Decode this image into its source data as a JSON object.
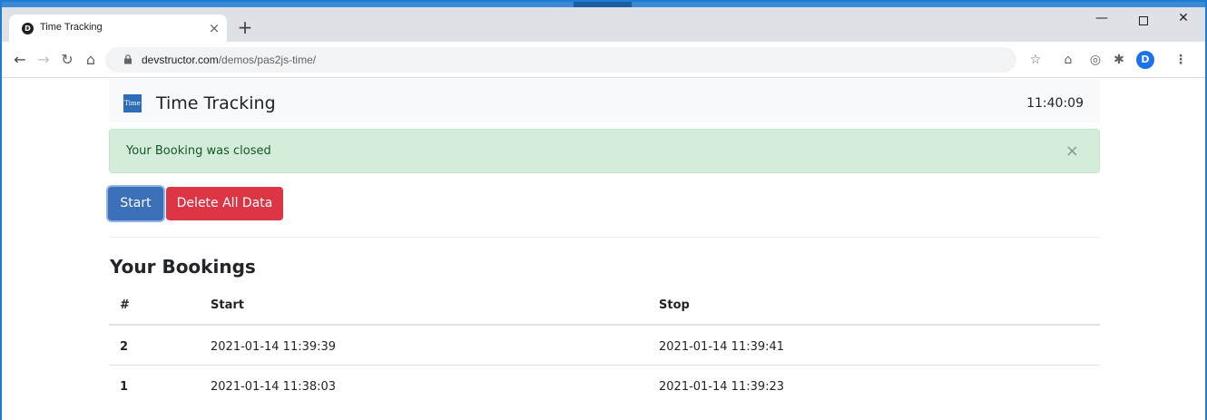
{
  "browser": {
    "tab_title": "Time Tracking",
    "tab_favicon": "D",
    "tab_close": "×",
    "new_tab": "+",
    "url_host": "devstructor.com",
    "url_path": "/demos/pas2js-time/",
    "profile_initial": "D",
    "icons": {
      "back": "arrow-left-icon",
      "forward": "arrow-right-icon",
      "reload": "reload-icon",
      "home": "home-icon",
      "lock": "lock-icon",
      "star": "star-icon",
      "menu": "kebab-menu-icon"
    }
  },
  "app": {
    "brand_logo_text": "Time",
    "brand_title": "Time Tracking",
    "clock": "11:40:09",
    "alert_message": "Your Booking was closed",
    "alert_close": "×",
    "start_label": "Start",
    "delete_label": "Delete All Data",
    "section_title": "Your Bookings",
    "colors": {
      "primary": "#3b6fb8",
      "danger": "#dc3545",
      "alert_bg": "#d4edda",
      "alert_text": "#155724"
    }
  },
  "table": {
    "headers": [
      "#",
      "Start",
      "Stop"
    ],
    "rows": [
      [
        "2",
        "2021-01-14 11:39:39",
        "2021-01-14 11:39:41"
      ],
      [
        "1",
        "2021-01-14 11:38:03",
        "2021-01-14 11:39:23"
      ]
    ]
  }
}
